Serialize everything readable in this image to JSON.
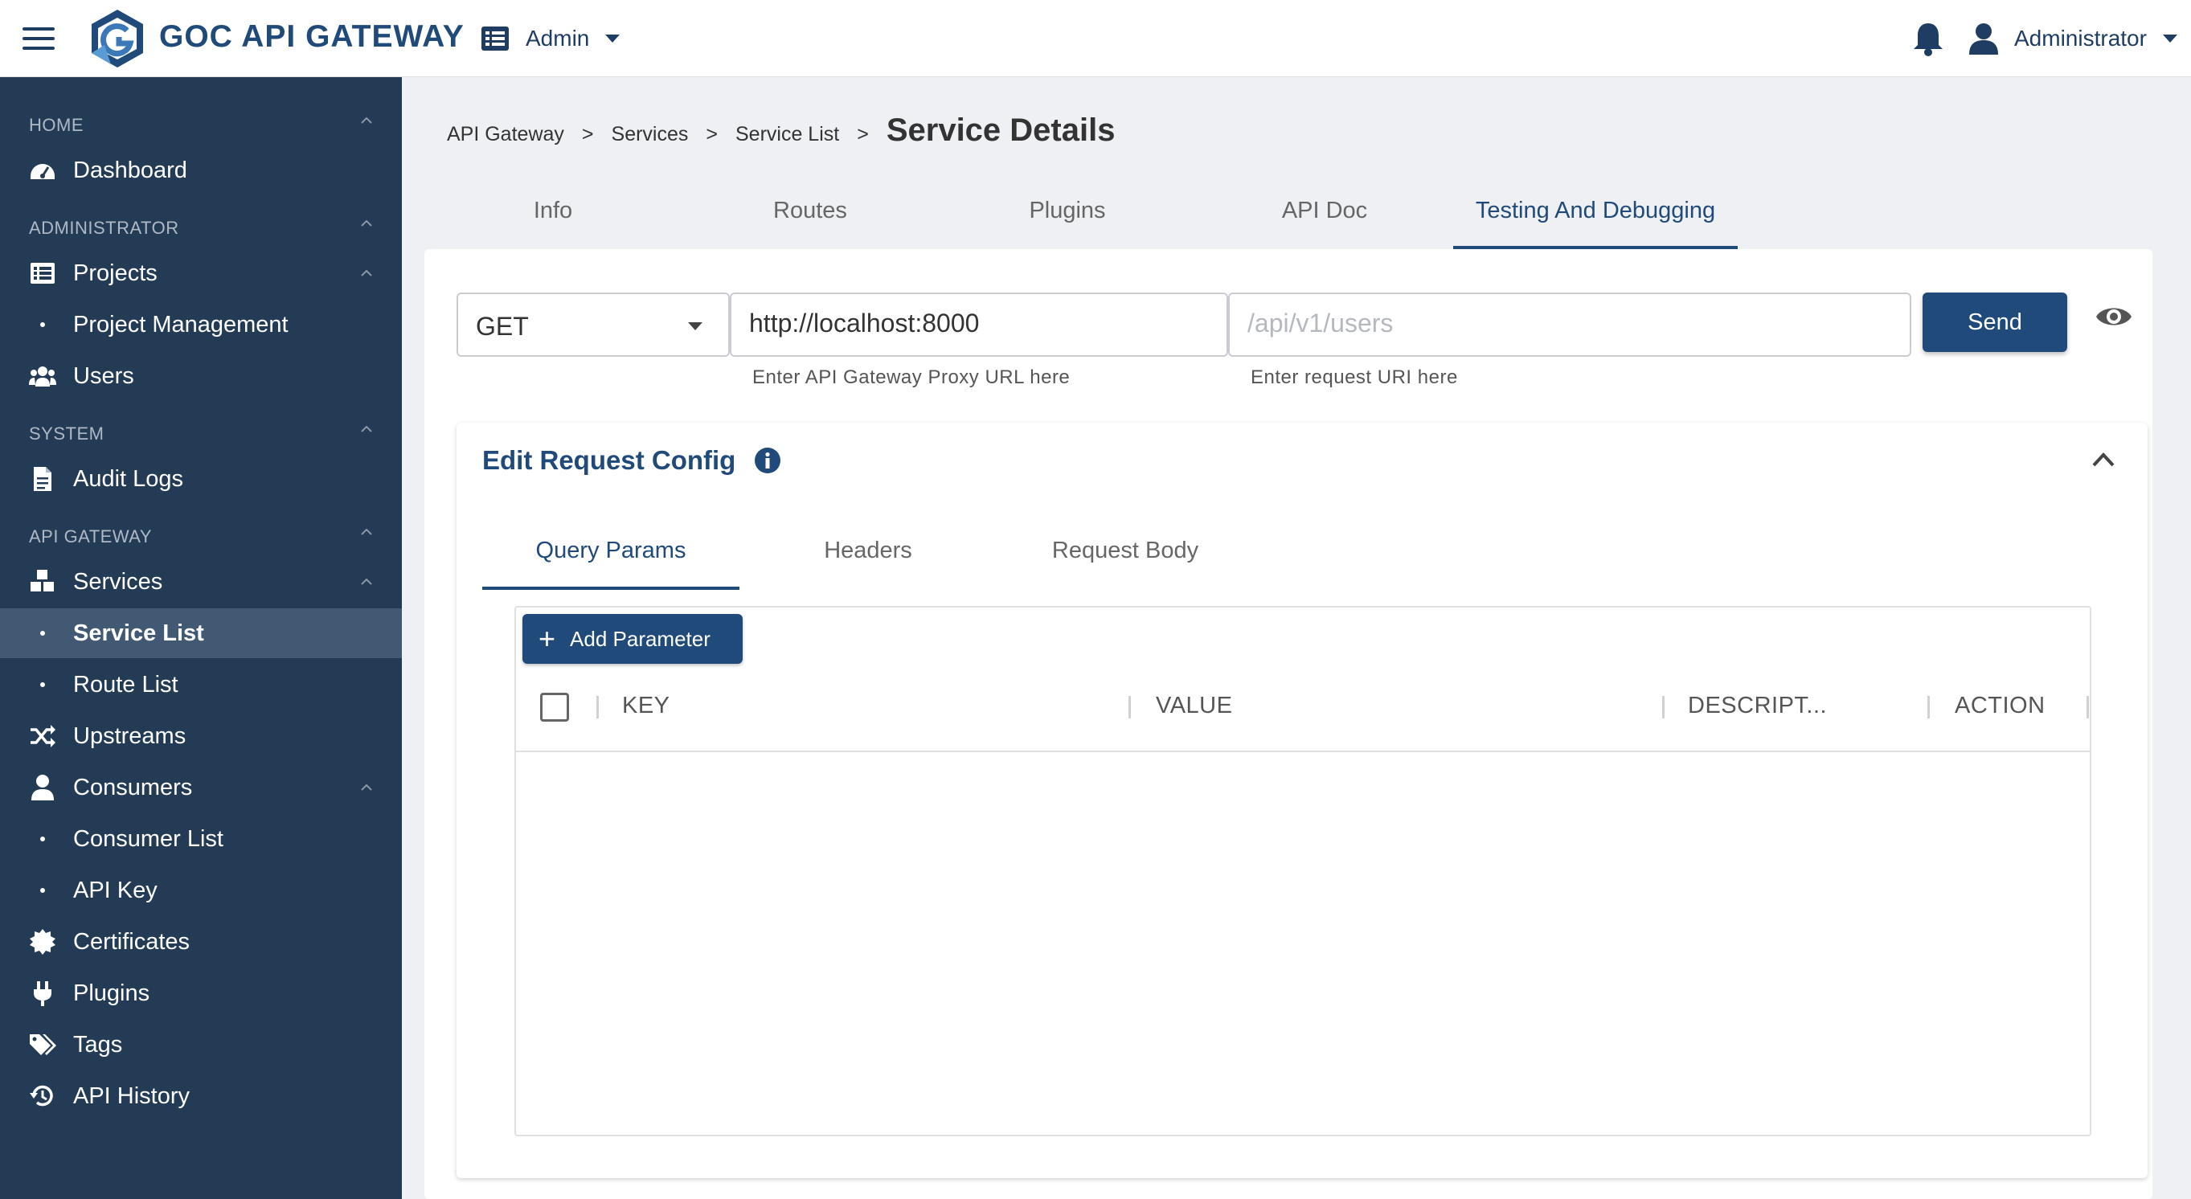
{
  "header": {
    "brand": "GOC API GATEWAY",
    "admin_menu_label": "Admin",
    "user_label": "Administrator",
    "brand_color": "#1f4a7a"
  },
  "sidebar": {
    "bg_color": "#233b55",
    "sections": {
      "home": "HOME",
      "administrator": "ADMINISTRATOR",
      "system": "SYSTEM",
      "api_gateway": "API GATEWAY"
    },
    "items": {
      "dashboard": "Dashboard",
      "projects": "Projects",
      "project_management": "Project Management",
      "users": "Users",
      "audit_logs": "Audit Logs",
      "services": "Services",
      "service_list": "Service List",
      "route_list": "Route List",
      "upstreams": "Upstreams",
      "consumers": "Consumers",
      "consumer_list": "Consumer List",
      "api_key": "API Key",
      "certificates": "Certificates",
      "plugins": "Plugins",
      "tags": "Tags",
      "api_history": "API History"
    },
    "active_item": "Service List"
  },
  "breadcrumb": {
    "items": [
      "API Gateway",
      "Services",
      "Service List"
    ],
    "separator": ">",
    "current": "Service Details"
  },
  "tabs": {
    "info": "Info",
    "routes": "Routes",
    "plugins": "Plugins",
    "api_doc": "API Doc",
    "testing": "Testing And Debugging",
    "active": "Testing And Debugging"
  },
  "request": {
    "method": "GET",
    "proxy_url_value": "http://localhost:8000",
    "proxy_url_hint": "Enter API Gateway Proxy URL here",
    "uri_placeholder": "/api/v1/users",
    "uri_hint": "Enter request URI here",
    "send_label": "Send"
  },
  "config": {
    "title": "Edit Request Config",
    "subtabs": {
      "query_params": "Query Params",
      "headers": "Headers",
      "request_body": "Request Body",
      "active": "Query Params"
    },
    "add_parameter_label": "Add Parameter",
    "columns": {
      "key": "KEY",
      "value": "VALUE",
      "description": "DESCRIPT...",
      "action": "ACTION"
    },
    "rows": []
  }
}
